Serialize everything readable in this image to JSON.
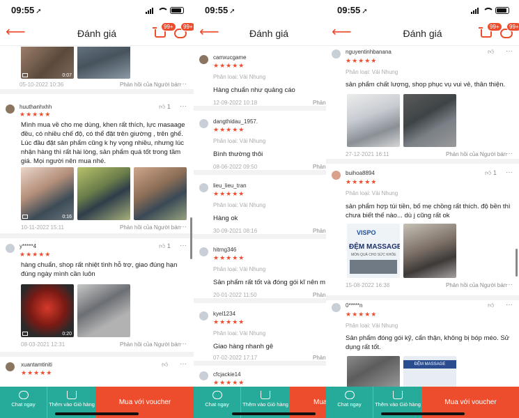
{
  "status": {
    "time": "09:55"
  },
  "header": {
    "title": "Đánh giá",
    "cart_badge": "99+",
    "chat_badge": "99+"
  },
  "bottom": {
    "chat": "Chat ngay",
    "add_cart": "Thêm vào Giỏ hàng",
    "buy": "Mua với voucher"
  },
  "variant_text": "Phân loại: Vải Nhung",
  "seller_reply": "Phản hồi của Người bán",
  "seller_reply_short": "Phản",
  "screen1": {
    "top_date": "05-10-2022 10:36",
    "top_duration": "0:07",
    "r1": {
      "user": "huuthanhxhh",
      "stars": "★★★★★",
      "likes": "1",
      "text": "Mình mua về cho mẹ dùng, khen rất thích, lực masaage đều, có nhiều chế độ, có thể đặt trên giường , trên ghế. Lúc đầu đặt sản phẩm cũng k hy vọng nhiều, nhưng lúc nhận hàng thì rất hài lòng, sản phẩm quá tốt trong tầm giá. Mọi người nên mua nhé.",
      "duration": "0:16",
      "date": "10-11-2022 15:11"
    },
    "r2": {
      "user": "y*****4",
      "stars": "★★★★★",
      "likes": "1",
      "text": "hàng chuẩn, shop rất nhiệt tình hỗ trợ, giao đúng hạn đúng ngày mình cần luôn",
      "duration": "0:20",
      "date": "08-03-2021 12:31"
    },
    "r3": {
      "user": "xuantamtiniti",
      "stars": "★★★★★"
    }
  },
  "screen2": {
    "reviews": [
      {
        "user": "camxucgame",
        "stars": "★★★★★",
        "text": "Hàng chuẩn như quảng cáo",
        "date": "12-09-2022 10:18"
      },
      {
        "user": "dangthidau_1957.",
        "stars": "★★★★★",
        "text": "Bình thường thôi",
        "date": "08-06-2022 09:50"
      },
      {
        "user": "lieu_lieu_tran",
        "stars": "★★★★★",
        "text": "Hàng ok",
        "date": "30-09-2021 08:16"
      },
      {
        "user": "hitrng346",
        "stars": "★★★★★",
        "text": "Sản phẩm rất tốt và đóng gói kĩ nên m",
        "date": "20-01-2022 11:50"
      },
      {
        "user": "kyel1234",
        "stars": "★★★★★",
        "text": "Giao hàng nhanh gê",
        "date": "07-02-2022 17:17"
      },
      {
        "user": "cfcjackie14",
        "stars": "★★★★★",
        "text": "",
        "date": ""
      }
    ]
  },
  "screen3": {
    "r1": {
      "user": "nguyentinhbanana",
      "stars": "★★★★★",
      "text": "sản phẩm chất lượng, shop phục vụ vui vẻ, thân thiện.",
      "date": "27-12-2021 16:11"
    },
    "r2": {
      "user": "buihoa8894",
      "stars": "★★★★★",
      "likes": "1",
      "text": "sản phẩm hợp túi tiền, bố mẹ chồng rất thích. độ bền thì chưa biết thế nào... dù j cũng rất ok",
      "img_brand": "VISPO",
      "img_title": "ĐỆM MASSAGE",
      "img_sub": "MÓN QUÀ CHO SỨC KHỎE",
      "date": "15-08-2022 16:38"
    },
    "r3": {
      "user": "0*****n",
      "stars": "★★★★★",
      "text": "Sản phẩm đóng gói kỹ, cẩn thận, không bị bóp méo. Sử dụng rất tốt.",
      "img_title": "ĐỆM MASSAGE"
    }
  }
}
